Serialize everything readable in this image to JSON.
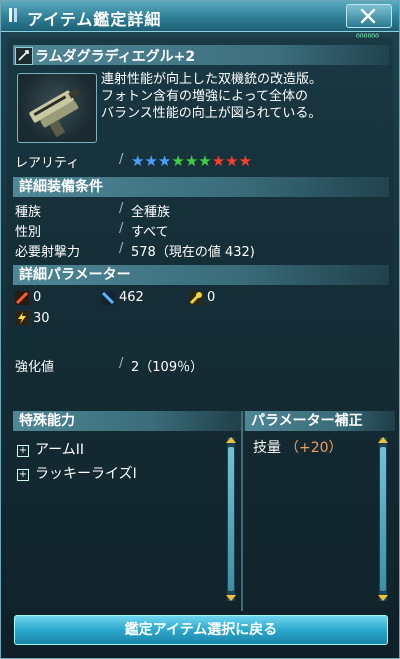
{
  "window": {
    "title": "アイテム鑑定詳細",
    "tiny_label": "000000"
  },
  "item": {
    "name": "ラムダグラディエグル+2",
    "description_lines": [
      "連射性能が向上した双機銃の改造版。",
      "フォトン含有の増強によって全体の",
      "バランス性能の向上が図られている。"
    ]
  },
  "rarity": {
    "label": "レアリティ",
    "star_count": 9,
    "star_colors": [
      "#4aa0ff",
      "#4aa0ff",
      "#4aa0ff",
      "#3ecf3e",
      "#3ecf3e",
      "#3ecf3e",
      "#ff3a2a",
      "#ff3a2a",
      "#ff3a2a"
    ]
  },
  "equip_conditions": {
    "heading": "詳細装備条件",
    "rows": [
      {
        "label": "種族",
        "value": "全種族"
      },
      {
        "label": "性別",
        "value": "すべて"
      },
      {
        "label": "必要射撃力",
        "value": "578（現在の値 432)"
      }
    ]
  },
  "parameters": {
    "heading": "詳細パラメーター",
    "items": [
      {
        "icon": "striking-attack-icon",
        "value": "0"
      },
      {
        "icon": "ranged-attack-icon",
        "value": "462"
      },
      {
        "icon": "technique-attack-icon",
        "value": "0"
      },
      {
        "icon": "lightning-element-icon",
        "value": "30"
      }
    ]
  },
  "enhancement": {
    "label": "強化値",
    "value": "2（109％）"
  },
  "special_abilities": {
    "heading": "特殊能力",
    "items": [
      "アームII",
      "ラッキーライズI"
    ]
  },
  "param_bonus": {
    "heading": "パラメーター補正",
    "stat": "技量",
    "amount": "（+20）"
  },
  "footer": {
    "return_label": "鑑定アイテム選択に戻る"
  },
  "colors": {
    "accent": "#2ca8cc",
    "bonus": "#f0a060",
    "scroll_arrow": "#f2c13a"
  }
}
